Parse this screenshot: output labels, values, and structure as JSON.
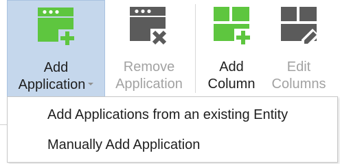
{
  "ribbon": {
    "add_application": {
      "line1": "Add",
      "line2": "Application",
      "icon": "add-application-icon"
    },
    "remove_application": {
      "line1": "Remove",
      "line2": "Application",
      "icon": "remove-application-icon"
    },
    "add_column": {
      "line1": "Add",
      "line2": "Column",
      "icon": "add-column-icon"
    },
    "edit_columns": {
      "line1": "Edit",
      "line2": "Columns",
      "icon": "edit-columns-icon"
    }
  },
  "dropdown": {
    "items": [
      "Add Applications from an existing Entity",
      "Manually Add Application"
    ]
  },
  "colors": {
    "active_highlight": "#c5d7ec",
    "green": "#5ec63f",
    "gray_icon": "#5b5b5b",
    "disabled_text": "#a2a2a2"
  }
}
